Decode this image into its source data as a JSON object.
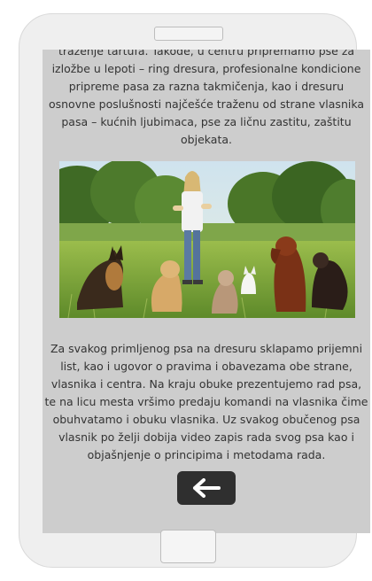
{
  "content": {
    "paragraph_top": "traženje tartufa. Takođe, u centru pripremamo pse za izložbe u lepoti – ring dresura, profesionalne kondicione pripreme pasa za razna takmičenja, kao i dresuru osnovne poslušnosti najčešće traženu od strane vlasnika pasa – kućnih ljubimaca, pse za ličnu zastitu, zaštitu objekata.",
    "paragraph_bottom": "Za svakog primljenog psa na dresuru sklapamo prijemni list, kao i ugovor o pravima i obavezama obe strane, vlasnika i centra. Na kraju obuke prezentujemo rad psa, te na licu mesta vršimo predaju komandi na vlasnika čime obuhvatamo i obuku vlasnika. Uz svakog obučenog psa vlasnik po želji dobija video zapis rada svog psa kao i objašnjenje o principima i metodama rada."
  },
  "photo": {
    "icon": "dog-training-photo"
  },
  "back_button": {
    "icon": "arrow-left-icon"
  },
  "colors": {
    "screen_bg": "#cdcdcd",
    "phone_body": "#efefef",
    "button_bg": "#2f2f2f",
    "text": "#333333"
  }
}
